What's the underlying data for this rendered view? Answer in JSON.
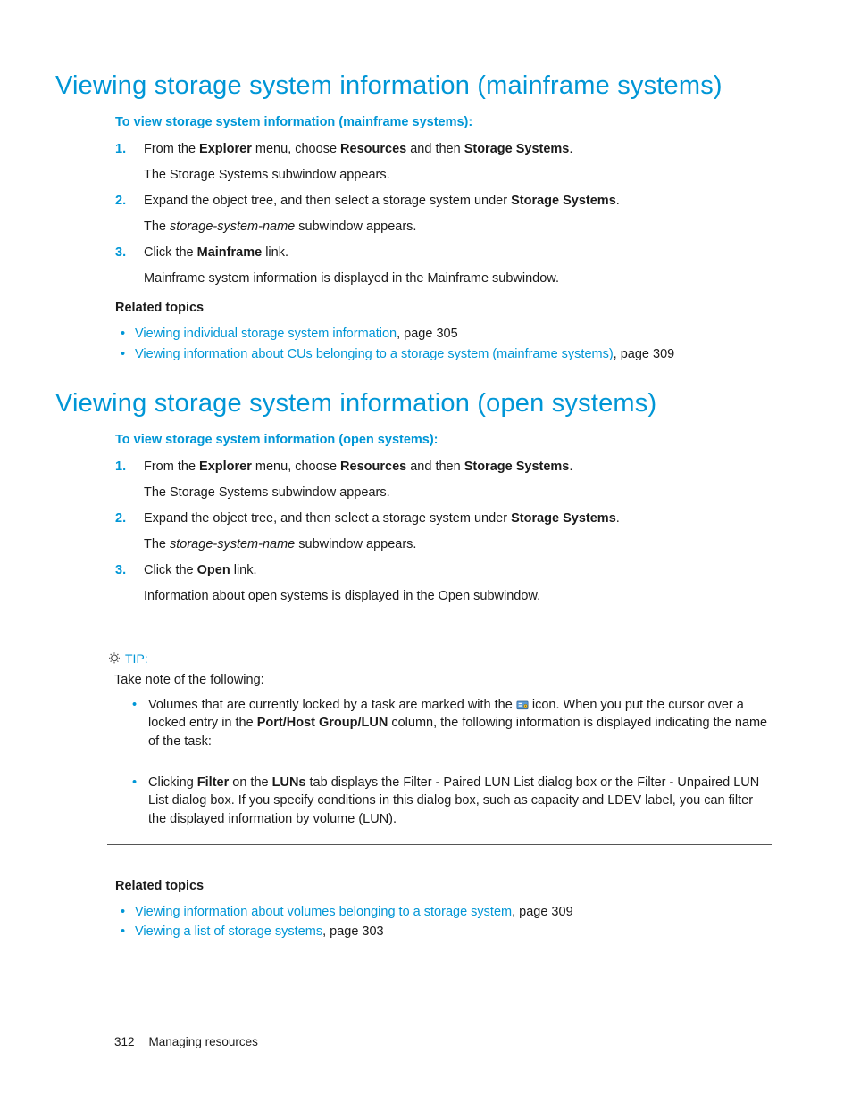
{
  "section1": {
    "heading": "Viewing storage system information (mainframe systems)",
    "intro": "To view storage system information (mainframe systems):",
    "step1_a": "From the ",
    "step1_b": "Explorer",
    "step1_c": " menu, choose ",
    "step1_d": "Resources",
    "step1_e": " and then ",
    "step1_f": "Storage Systems",
    "step1_g": ".",
    "step1_sub": "The Storage Systems subwindow appears.",
    "step2_a": "Expand the object tree, and then select a storage system under ",
    "step2_b": "Storage Systems",
    "step2_c": ".",
    "step2_sub_a": "The ",
    "step2_sub_b": "storage-system-name",
    "step2_sub_c": " subwindow appears.",
    "step3_a": "Click the ",
    "step3_b": "Mainframe",
    "step3_c": " link.",
    "step3_sub": "Mainframe system information is displayed in the Mainframe subwindow.",
    "related_heading": "Related topics",
    "rel1_link": "Viewing individual storage system information",
    "rel1_tail": ", page 305",
    "rel2_link": "Viewing information about CUs belonging to a storage system (mainframe systems)",
    "rel2_tail": ", page 309"
  },
  "section2": {
    "heading": "Viewing storage system information (open systems)",
    "intro": "To view storage system information (open systems):",
    "step1_a": "From the ",
    "step1_b": "Explorer",
    "step1_c": " menu, choose ",
    "step1_d": "Resources",
    "step1_e": " and then ",
    "step1_f": "Storage Systems",
    "step1_g": ".",
    "step1_sub": "The Storage Systems subwindow appears.",
    "step2_a": "Expand the object tree, and then select a storage system under ",
    "step2_b": "Storage Systems",
    "step2_c": ".",
    "step2_sub_a": "The ",
    "step2_sub_b": "storage-system-name",
    "step2_sub_c": " subwindow appears.",
    "step3_a": "Click the ",
    "step3_b": "Open",
    "step3_c": " link.",
    "step3_sub": "Information about open systems is displayed in the Open subwindow."
  },
  "tip": {
    "label": "TIP:",
    "intro": "Take note of the following:",
    "item1_a": "Volumes that are currently locked by a task are marked with the ",
    "item1_b": " icon. When you put the cursor over a locked entry in the ",
    "item1_c": "Port/Host Group/LUN",
    "item1_d": " column, the following information is displayed indicating the name of the task:",
    "item2_a": "Clicking ",
    "item2_b": "Filter",
    "item2_c": " on the ",
    "item2_d": "LUNs",
    "item2_e": " tab displays the Filter - Paired LUN List dialog box or the Filter - Unpaired LUN List dialog box. If you specify conditions in this dialog box, such as capacity and LDEV label, you can filter the displayed information by volume (LUN)."
  },
  "section2_related": {
    "heading": "Related topics",
    "rel1_link": "Viewing information about volumes belonging to a storage system",
    "rel1_tail": ", page 309",
    "rel2_link": "Viewing a list of storage systems",
    "rel2_tail": ", page 303"
  },
  "footer": {
    "page": "312",
    "chapter": "Managing resources"
  }
}
